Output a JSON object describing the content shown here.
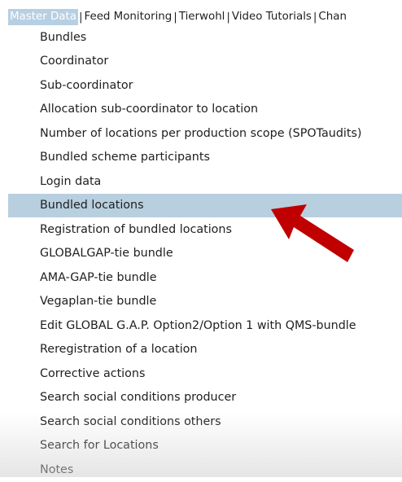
{
  "top_nav": {
    "tabs": [
      {
        "label": "Master Data"
      },
      {
        "label": "Feed Monitoring"
      },
      {
        "label": "Tierwohl"
      },
      {
        "label": "Video Tutorials"
      },
      {
        "label": "Chan"
      }
    ],
    "separator": "|"
  },
  "menu": {
    "items": [
      {
        "label": "Bundles"
      },
      {
        "label": "Coordinator"
      },
      {
        "label": "Sub-coordinator"
      },
      {
        "label": "Allocation sub-coordinator to location"
      },
      {
        "label": "Number of locations per production scope (SPOTaudits)"
      },
      {
        "label": "Bundled scheme participants"
      },
      {
        "label": "Login data"
      },
      {
        "label": "Bundled locations"
      },
      {
        "label": "Registration of bundled locations"
      },
      {
        "label": "GLOBALGAP-tie bundle"
      },
      {
        "label": "AMA-GAP-tie bundle"
      },
      {
        "label": "Vegaplan-tie bundle"
      },
      {
        "label": "Edit GLOBAL G.A.P. Option2/Option 1 with QMS-bundle"
      },
      {
        "label": "Reregistration of a location"
      },
      {
        "label": "Corrective actions"
      },
      {
        "label": "Search social conditions producer"
      },
      {
        "label": "Search social conditions others"
      },
      {
        "label": "Search for Locations"
      },
      {
        "label": "Notes"
      }
    ],
    "highlighted_item": "Bundled locations"
  },
  "colors": {
    "active_tab_bg": "#b7cfe2",
    "highlight_bg": "#b8cfe0",
    "arrow": "#c00000"
  },
  "icons": {
    "pointer_arrow": "red-arrow-icon"
  }
}
